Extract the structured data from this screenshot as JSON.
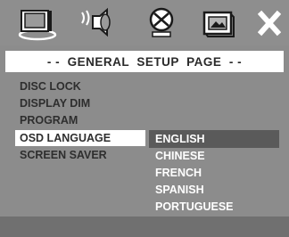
{
  "toolbar": {
    "icons": [
      "tv-icon",
      "speaker-icon",
      "disc-icon",
      "picture-icon",
      "close-icon"
    ]
  },
  "page_title": "- -  GENERAL  SETUP  PAGE  - -",
  "menu": {
    "items": [
      {
        "label": "DISC LOCK"
      },
      {
        "label": "DISPLAY DIM"
      },
      {
        "label": "PROGRAM"
      },
      {
        "label": "OSD LANGUAGE"
      },
      {
        "label": "SCREEN SAVER"
      }
    ],
    "selected_index": 3
  },
  "submenu": {
    "options": [
      {
        "label": "ENGLISH"
      },
      {
        "label": "CHINESE"
      },
      {
        "label": "FRENCH"
      },
      {
        "label": "SPANISH"
      },
      {
        "label": "PORTUGUESE"
      }
    ],
    "selected_index": 0
  },
  "colors": {
    "background": "#8c8c8c",
    "highlight": "#ffffff",
    "submenu_highlight": "#5a5a5a",
    "text_dark": "#2e2e2e",
    "text_light": "#ffffff"
  }
}
